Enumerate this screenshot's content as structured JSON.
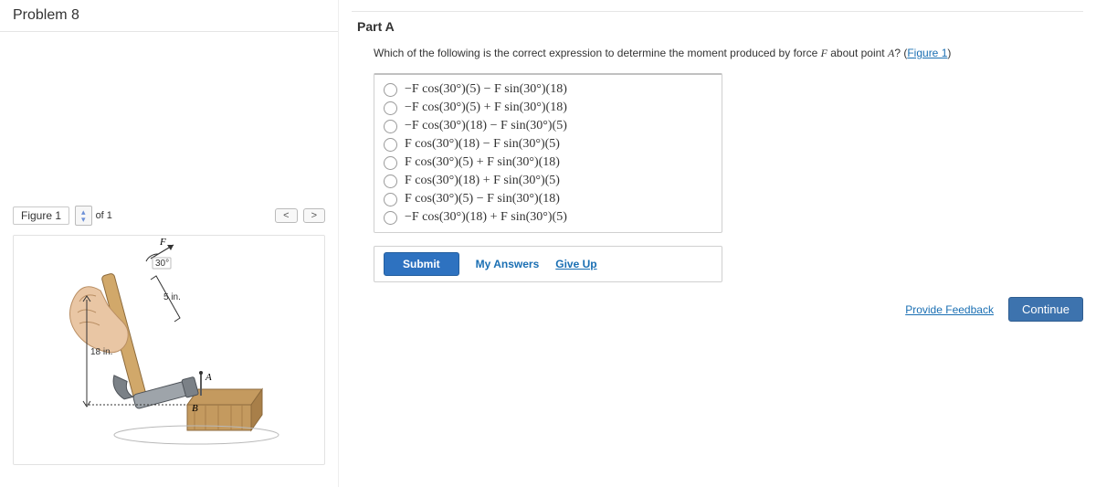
{
  "problem_title": "Problem 8",
  "figure": {
    "label": "Figure 1",
    "total": "of 1",
    "prev": "<",
    "next": ">",
    "force_label": "F",
    "angle_label": "30°",
    "arm_label": "5 in.",
    "height_label": "18 in.",
    "point_A": "A",
    "point_B": "B"
  },
  "part_a": {
    "title": "Part A",
    "question_pre": "Which of the following is the correct expression to determine the moment produced by force ",
    "var_F": "F",
    "question_mid": " about point ",
    "var_A": "A",
    "question_post": "? (",
    "figure_link": "Figure 1",
    "question_close": ")",
    "options": [
      "−F cos(30°)(5) − F sin(30°)(18)",
      "−F cos(30°)(5) + F sin(30°)(18)",
      "−F cos(30°)(18) − F sin(30°)(5)",
      "F cos(30°)(18) − F sin(30°)(5)",
      "F cos(30°)(5) + F sin(30°)(18)",
      "F cos(30°)(18) + F sin(30°)(5)",
      "F cos(30°)(5) − F sin(30°)(18)",
      "−F cos(30°)(18) + F sin(30°)(5)"
    ],
    "submit": "Submit",
    "my_answers": "My Answers",
    "give_up": "Give Up"
  },
  "footer": {
    "provide_feedback": "Provide Feedback",
    "continue": "Continue"
  }
}
